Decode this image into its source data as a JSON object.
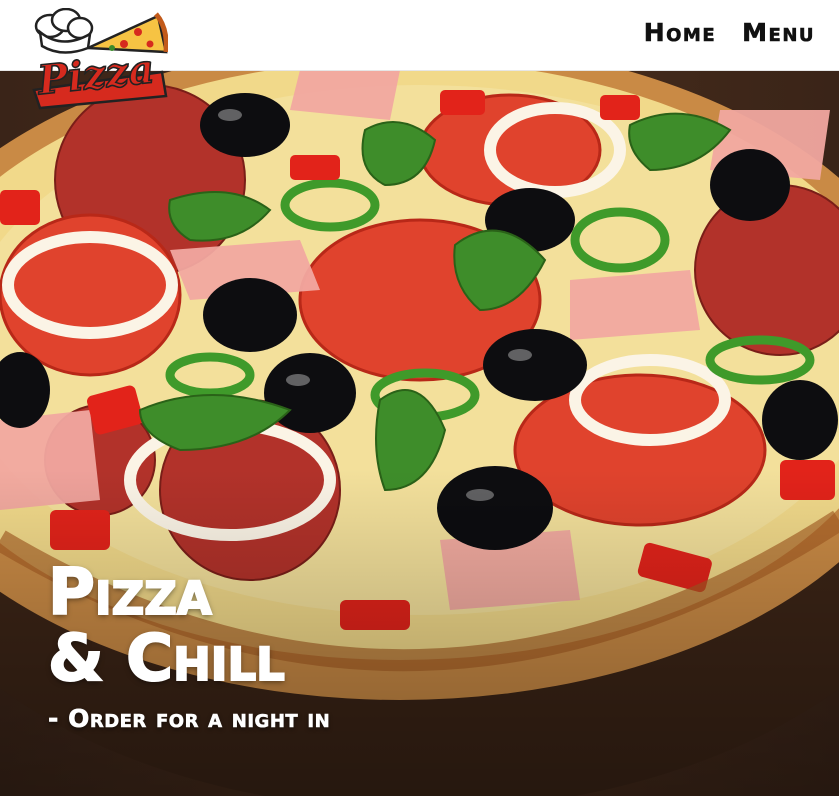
{
  "nav": {
    "items": [
      {
        "label": "Home"
      },
      {
        "label": "Menu"
      }
    ]
  },
  "logo": {
    "text": "Pizza"
  },
  "hero": {
    "title_line1": "Pizza",
    "title_line2": "& Chill",
    "subtitle": "- Order for a night in",
    "image": "pizza-photo"
  },
  "colors": {
    "logo_red": "#d62a1e",
    "header_bg": "#ffffff",
    "text_light": "#ffffff"
  }
}
